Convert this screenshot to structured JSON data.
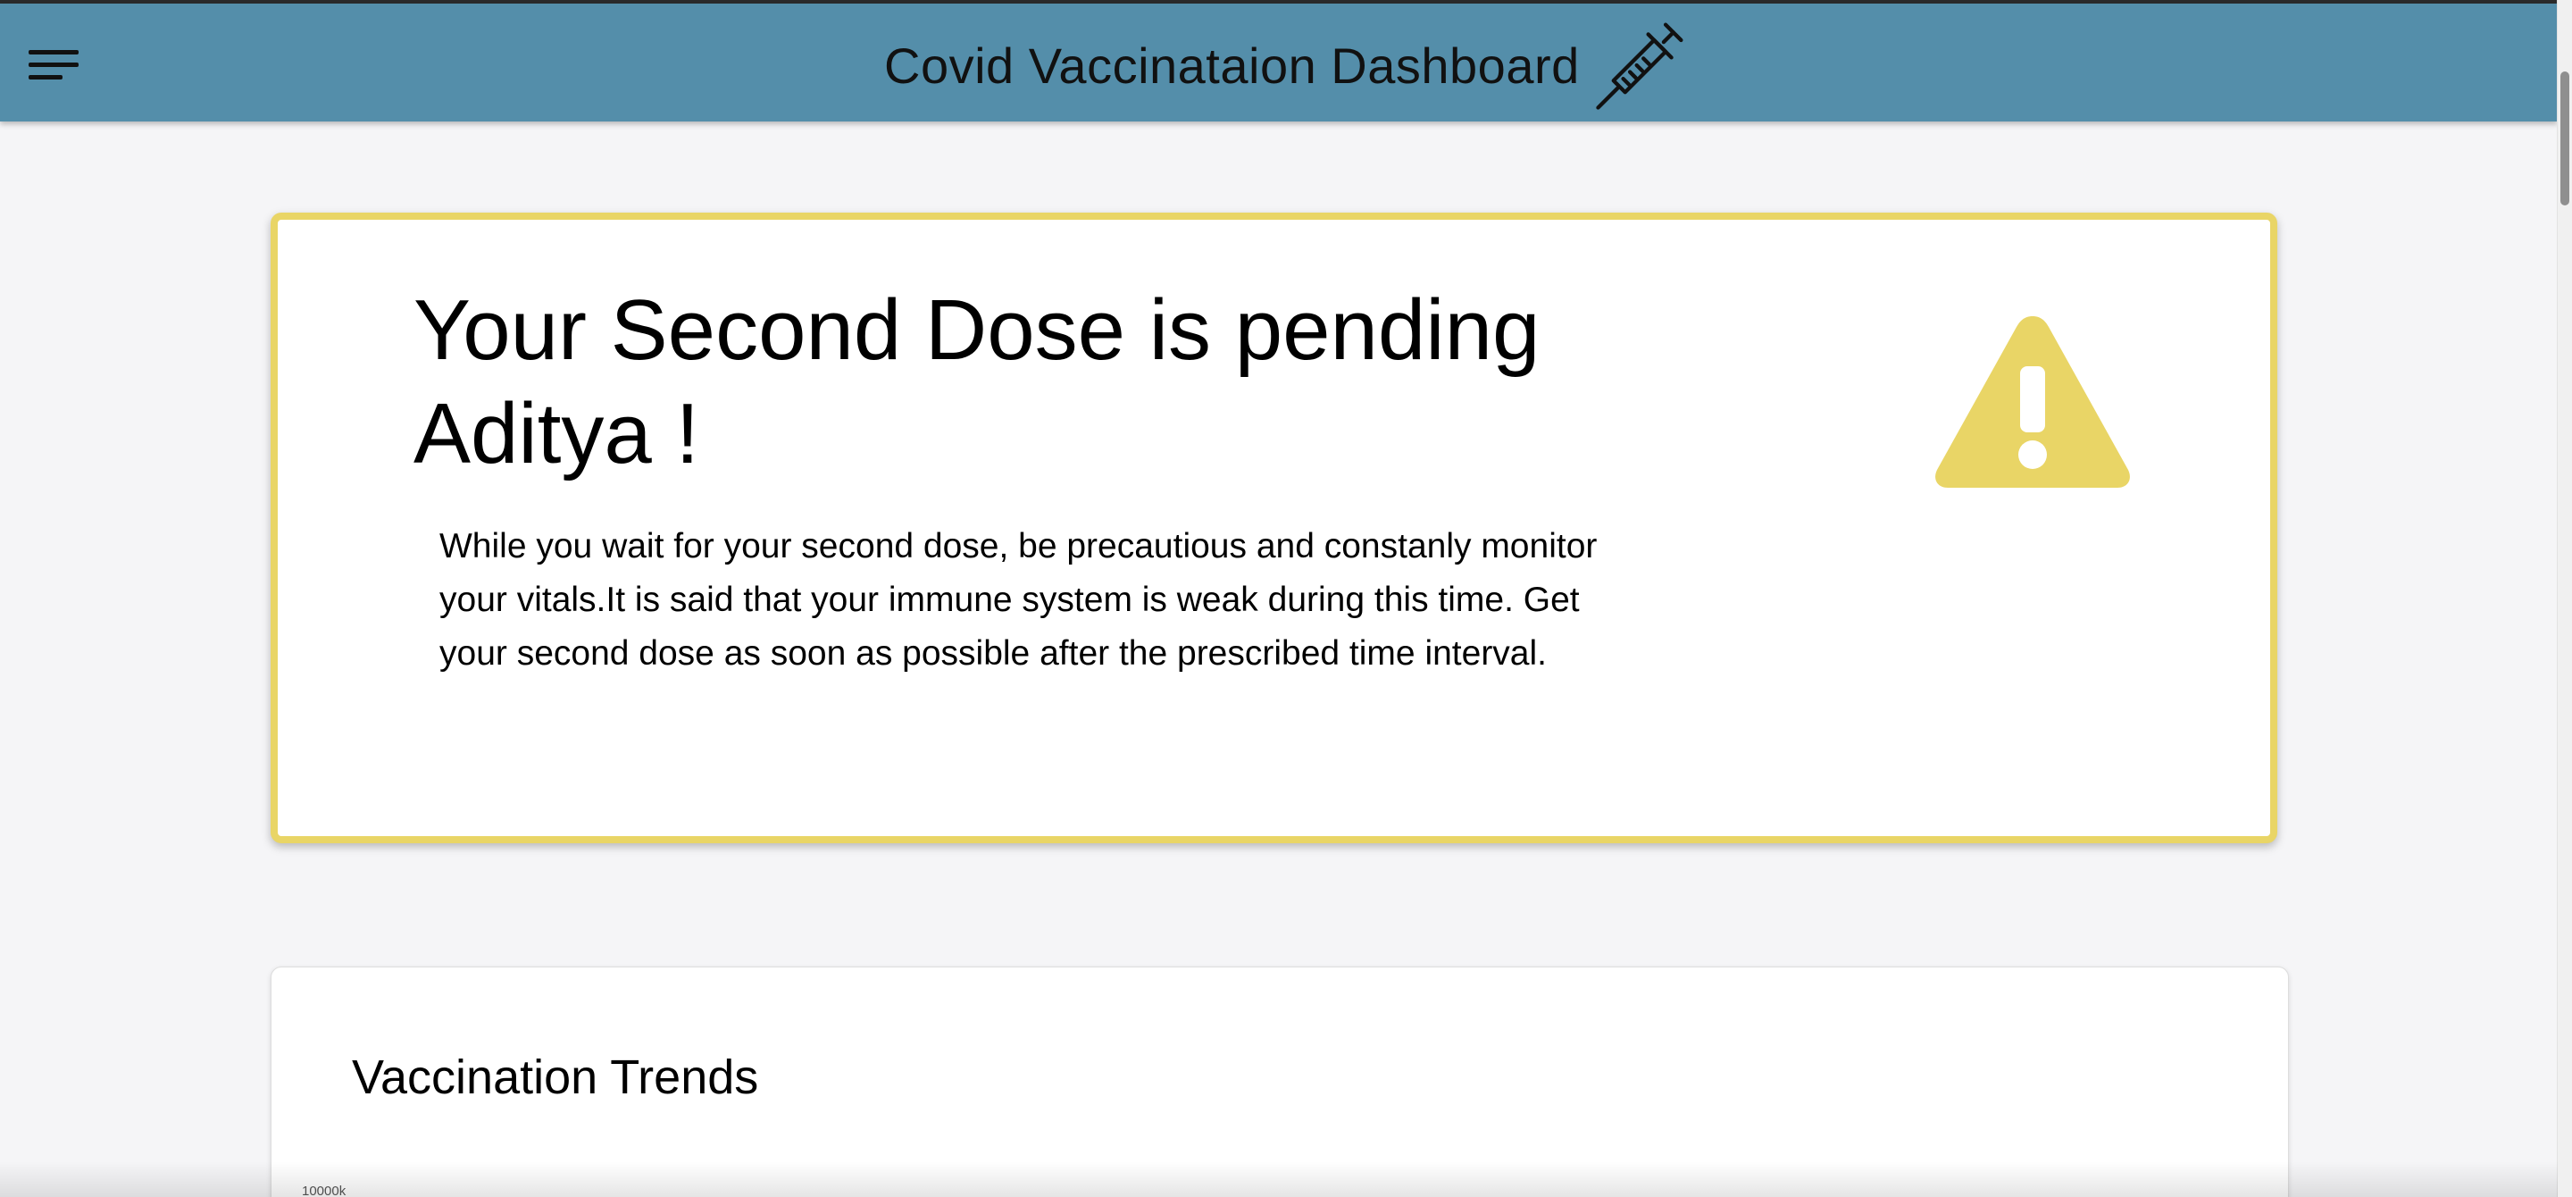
{
  "header": {
    "title": "Covid Vaccinataion Dashboard",
    "menu_icon": "hamburger-menu-icon",
    "title_icon": "syringe-icon",
    "background": "#548eaa"
  },
  "alert": {
    "heading": "Your Second Dose is pending Aditya !",
    "body": "While you wait for your second dose, be precautious and constanly monitor your vitals.It is said that your immune system is weak during this time. Get your second dose as soon as possible after the prescribed time interval.",
    "icon": "warning-icon",
    "accent_color": "#e9d566"
  },
  "trends": {
    "title": "Vaccination Trends",
    "y_tick_top": "10000k"
  }
}
